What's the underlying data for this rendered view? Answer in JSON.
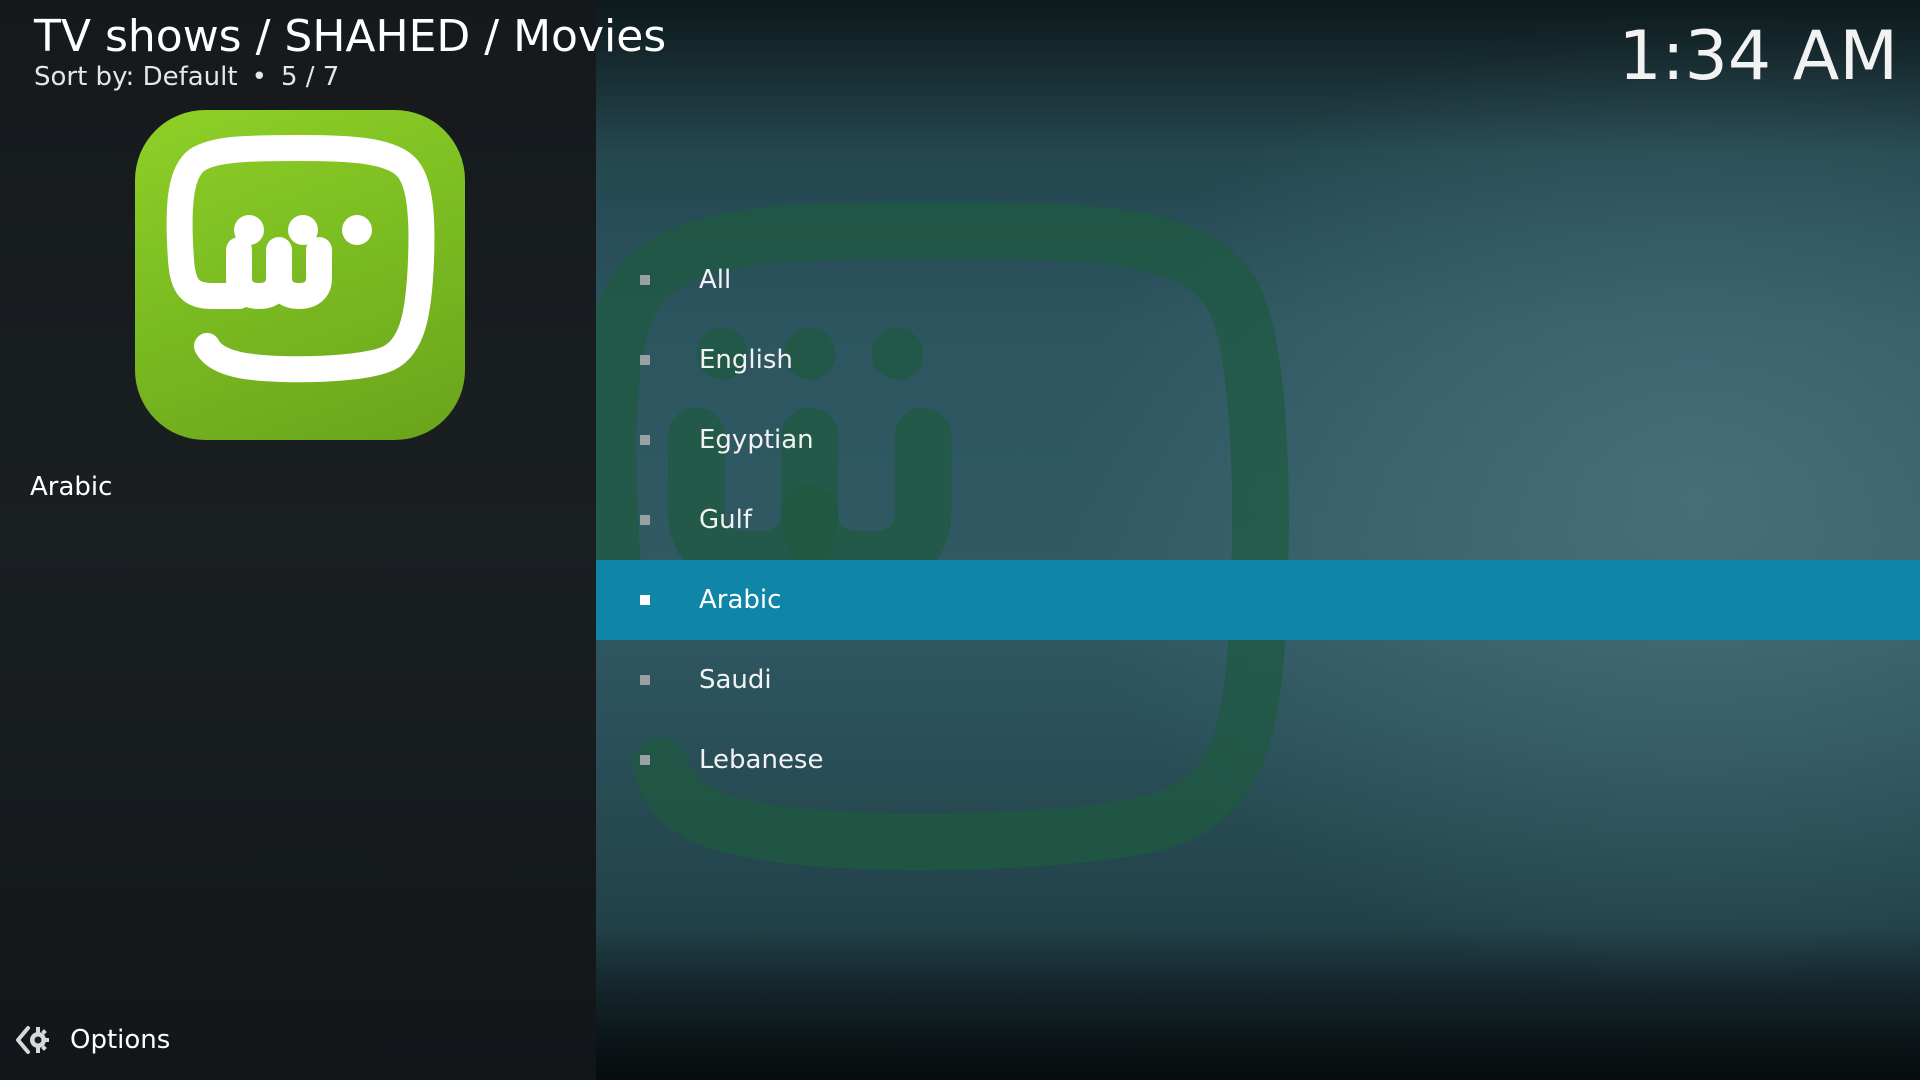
{
  "header": {
    "breadcrumb": "TV shows / SHAHED / Movies",
    "sort_label": "Sort by: Default",
    "separator": "•",
    "position": "5 / 7"
  },
  "clock": "1:34 AM",
  "info_panel": {
    "poster_icon": "shahid-logo-icon",
    "selected_label": "Arabic"
  },
  "list": {
    "items": [
      {
        "label": "All"
      },
      {
        "label": "English"
      },
      {
        "label": "Egyptian"
      },
      {
        "label": "Gulf"
      },
      {
        "label": "Arabic",
        "selected": true
      },
      {
        "label": "Saudi"
      },
      {
        "label": "Lebanese"
      }
    ]
  },
  "footer": {
    "options_icon": "options-gear-icon",
    "options_label": "Options"
  },
  "colors": {
    "selection": "#0f86a7",
    "brand_green": "#7cbd22"
  }
}
